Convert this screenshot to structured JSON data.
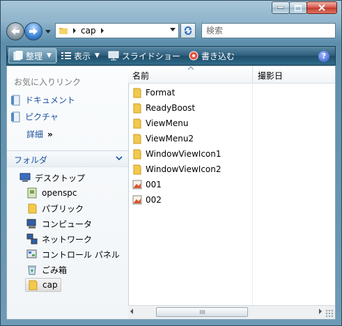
{
  "address": {
    "path": "cap"
  },
  "search": {
    "placeholder": "検索"
  },
  "toolbar": {
    "organize_label": "整理",
    "view_label": "表示",
    "slideshow_label": "スライドショー",
    "burn_label": "書き込む"
  },
  "navpane": {
    "favorites_title": "お気に入りリンク",
    "favorites": [
      {
        "label": "ドキュメント"
      },
      {
        "label": "ピクチャ"
      }
    ],
    "more_label": "詳細",
    "more_chevron": "»",
    "folders_title": "フォルダ",
    "tree": [
      {
        "label": "デスクトップ",
        "icon": "desktop-icon"
      },
      {
        "label": "openspc",
        "icon": "user-folder-icon"
      },
      {
        "label": "パブリック",
        "icon": "folder-icon"
      },
      {
        "label": "コンピュータ",
        "icon": "computer-icon"
      },
      {
        "label": "ネットワーク",
        "icon": "network-icon"
      },
      {
        "label": "コントロール パネル",
        "icon": "control-panel-icon"
      },
      {
        "label": "ごみ箱",
        "icon": "recycle-bin-icon"
      },
      {
        "label": "cap",
        "icon": "folder-icon",
        "selected": true
      }
    ]
  },
  "filelist": {
    "columns": [
      "名前",
      "撮影日"
    ],
    "items": [
      {
        "name": "Format",
        "type": "folder"
      },
      {
        "name": "ReadyBoost",
        "type": "folder"
      },
      {
        "name": "ViewMenu",
        "type": "folder"
      },
      {
        "name": "ViewMenu2",
        "type": "folder"
      },
      {
        "name": "WindowViewIcon1",
        "type": "folder"
      },
      {
        "name": "WindowViewIcon2",
        "type": "folder"
      },
      {
        "name": "001",
        "type": "image"
      },
      {
        "name": "002",
        "type": "image"
      }
    ]
  },
  "colors": {
    "link": "#1a4f9c",
    "toolbar": "#2d5d7b",
    "folder": "#f2c94c"
  }
}
